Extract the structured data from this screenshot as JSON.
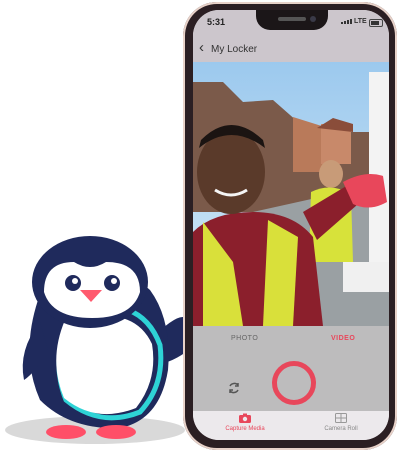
{
  "mascot": {
    "icon": "penguin-mascot-icon"
  },
  "status_bar": {
    "time": "5:31",
    "network": "LTE",
    "icons": [
      "location-arrow-icon",
      "signal-bars-icon",
      "battery-icon"
    ]
  },
  "header": {
    "back_icon": "chevron-left-icon",
    "title": "My Locker"
  },
  "camera": {
    "preview": "photo-preview",
    "modes": [
      {
        "label": "PHOTO",
        "selected": false
      },
      {
        "label": "VIDEO",
        "selected": true
      }
    ],
    "switch_icon": "camera-switch-icon",
    "shutter_icon": "record-button-icon"
  },
  "tabs": [
    {
      "label": "Capture Media",
      "icon": "camera-icon",
      "active": true
    },
    {
      "label": "Camera Roll",
      "icon": "gallery-icon",
      "active": false
    }
  ],
  "colors": {
    "accent": "#e8475b",
    "bar": "#ccc6cc",
    "controls": "#bdbcbd"
  }
}
